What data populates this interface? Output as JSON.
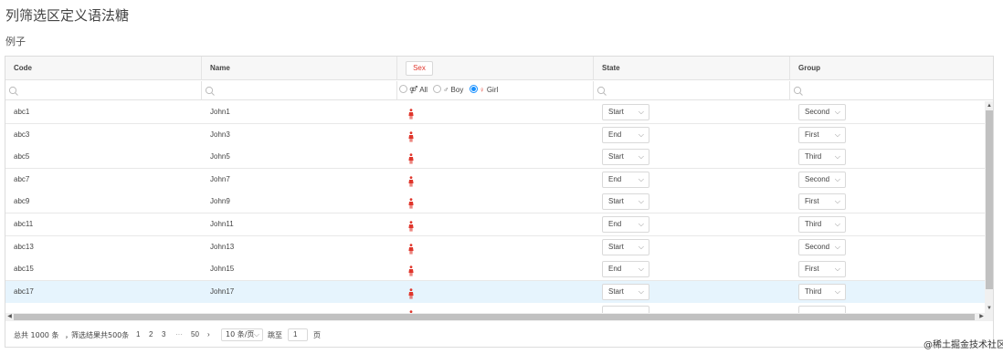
{
  "page": {
    "title": "列筛选区定义语法糖",
    "example_label": "例子"
  },
  "table": {
    "columns": [
      "Code",
      "Name",
      "Sex",
      "State",
      "Group"
    ],
    "sex_filter": {
      "all": "All",
      "boy": "Boy",
      "girl": "Girl",
      "selected": "Girl"
    },
    "rows": [
      {
        "code": "abc1",
        "name": "John1",
        "state": "Start",
        "group": "Second"
      },
      {
        "code": "abc3",
        "name": "John3",
        "state": "End",
        "group": "First"
      },
      {
        "code": "abc5",
        "name": "John5",
        "state": "Start",
        "group": "Third"
      },
      {
        "code": "abc7",
        "name": "John7",
        "state": "End",
        "group": "Second"
      },
      {
        "code": "abc9",
        "name": "John9",
        "state": "Start",
        "group": "First"
      },
      {
        "code": "abc11",
        "name": "John11",
        "state": "End",
        "group": "Third"
      },
      {
        "code": "abc13",
        "name": "John13",
        "state": "Start",
        "group": "Second"
      },
      {
        "code": "abc15",
        "name": "John15",
        "state": "End",
        "group": "First"
      },
      {
        "code": "abc17",
        "name": "John17",
        "state": "Start",
        "group": "Third"
      }
    ],
    "selected_row": "abc17"
  },
  "pagination": {
    "total": "总共 1000 条",
    "filtered": "筛选结果共500条",
    "prev": "‹",
    "pages": [
      "1",
      "2",
      "3"
    ],
    "ellipsis": "···",
    "last_page": "50",
    "next": "›",
    "page_size": "10 条/页",
    "jump_label": "跳至",
    "jump_value": "1",
    "page_unit": "页"
  },
  "watermark": "@稀土掘金技术社区",
  "colors": {
    "accent": "#1890ff",
    "girl": "#e0362c",
    "selected_row": "#e6f4fd"
  },
  "icons": {
    "filter": "search-icon",
    "gender": "female-icon",
    "dropdown": "chevron-down-icon"
  }
}
